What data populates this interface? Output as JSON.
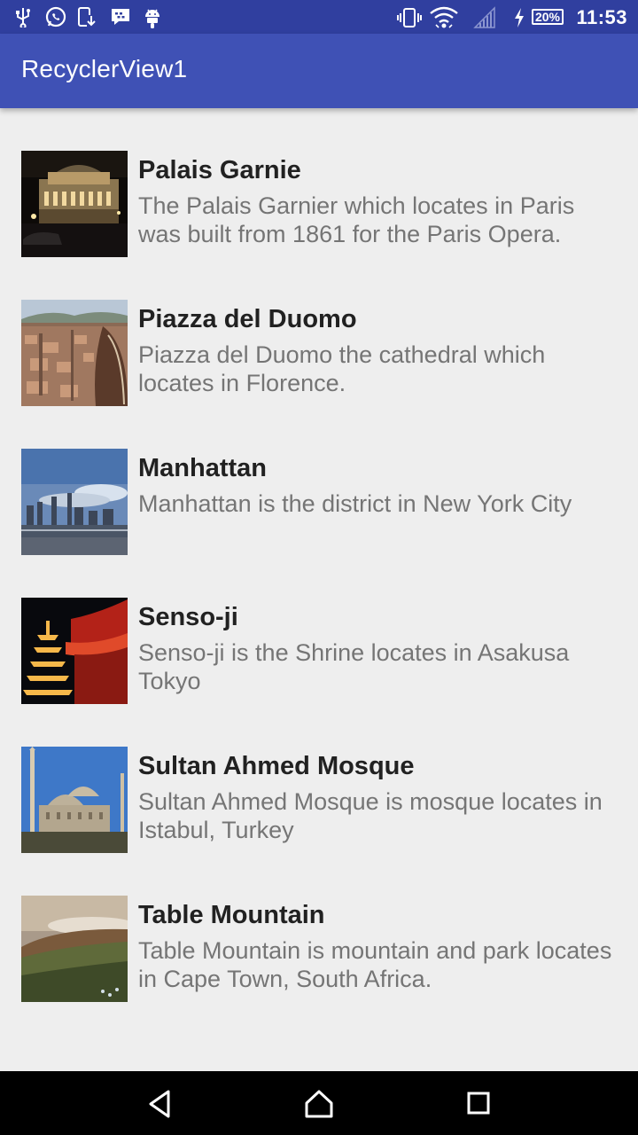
{
  "status_bar": {
    "battery": "20%",
    "time": "11:53"
  },
  "app_bar": {
    "title": "RecyclerView1"
  },
  "items": [
    {
      "title": "Palais Garnie",
      "description": "The Palais Garnier which locates in Paris was built from 1861 for the Paris Opera."
    },
    {
      "title": "Piazza del Duomo",
      "description": "Piazza del Duomo the cathedral which locates in Florence."
    },
    {
      "title": "Manhattan",
      "description": "Manhattan is the district in New York City"
    },
    {
      "title": "Senso-ji",
      "description": "Senso-ji is the Shrine locates in Asakusa Tokyo"
    },
    {
      "title": "Sultan Ahmed Mosque",
      "description": "Sultan Ahmed Mosque is mosque locates in Istabul, Turkey"
    },
    {
      "title": "Table Mountain",
      "description": "Table Mountain is mountain and park locates in Cape Town, South Africa."
    }
  ],
  "nav_bar": {
    "icons": [
      "back-icon",
      "home-icon",
      "recents-icon"
    ]
  },
  "colors": {
    "status_bar": "#303f9f",
    "app_bar": "#3f51b5",
    "background": "#eeeeee",
    "title_text": "#212121",
    "description_text": "#757575"
  }
}
